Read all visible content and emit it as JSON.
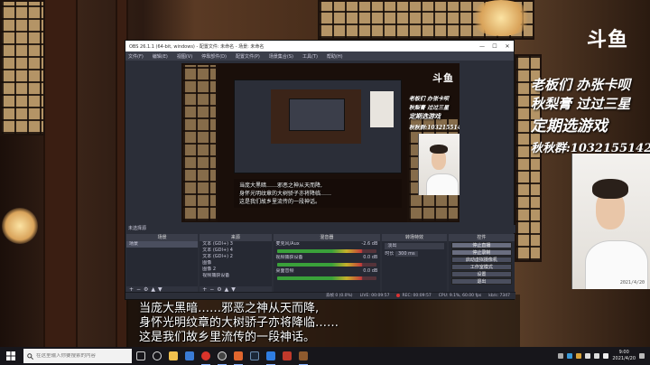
{
  "stream_overlay": {
    "platform_logo": "斗鱼",
    "lines": [
      "老板们 办张卡呗",
      "秋梨膏 过过三星",
      "定期选游戏",
      "秋秋群:1032155142"
    ],
    "webcam_caption": "2021/4/20"
  },
  "subtitles": {
    "line1": "当庞大黑暗……邪恶之神从天而降,",
    "line2": "身怀光明纹章的大树骄子亦将降临……",
    "line3": "这是我们故乡里流传的一段神话。"
  },
  "obs": {
    "title": "OBS 26.1.1 (64-bit, windows) - 配置文件: 未命名 - 场景: 未命名",
    "menu": [
      "文件(F)",
      "编辑(E)",
      "视图(V)",
      "停靠部件(D)",
      "配置文件(P)",
      "场景集合(S)",
      "工具(T)",
      "帮助(H)"
    ],
    "preview_label": "未选择源",
    "docks": {
      "scenes": {
        "title": "场景",
        "items": [
          "场景"
        ]
      },
      "sources": {
        "title": "来源",
        "items": [
          "文本 (GDI+) 3",
          "文本 (GDI+) 4",
          "文本 (GDI+) 2",
          "图像",
          "图像 2",
          "视频捕获设备"
        ]
      },
      "mixer": {
        "title": "混音器",
        "channels": [
          {
            "name": "麦克风/Aux",
            "level": "-2.6 dB"
          },
          {
            "name": "视频捕获设备",
            "level": "0.0 dB"
          },
          {
            "name": "桌面音频",
            "level": "0.0 dB"
          }
        ]
      },
      "transitions": {
        "title": "转场特效",
        "type": "淡出",
        "duration_label": "时长",
        "duration_value": "300 ms"
      },
      "controls": {
        "title": "控件",
        "buttons": [
          "停止直播",
          "停止录制",
          "启动虚拟摄像机",
          "工作室模式",
          "设置",
          "退出"
        ]
      }
    },
    "status": {
      "dropped": "丢帧 0 (0.0%)",
      "live": "LIVE: 00:09:57",
      "rec": "REC: 00:09:57",
      "cpu": "CPU: 9.1%, 60.00 fps",
      "bitrate": "kb/s: 7347"
    }
  },
  "taskbar": {
    "search_placeholder": "在这里输入你要搜索的内容",
    "time": "9:00",
    "date": "2021/4/20"
  }
}
